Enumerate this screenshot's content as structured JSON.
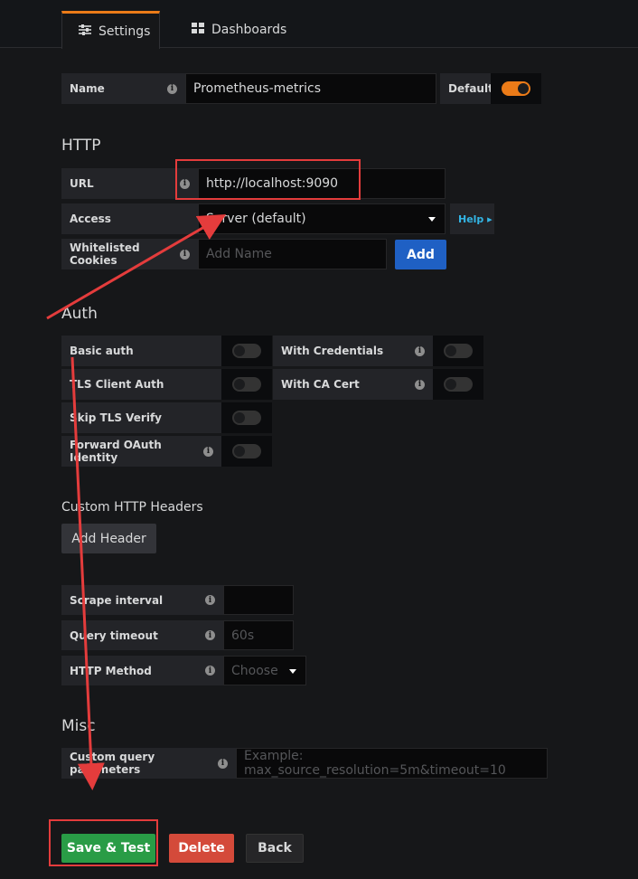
{
  "tabs": [
    {
      "label": "Settings",
      "icon": "sliders-icon",
      "active": true
    },
    {
      "label": "Dashboards",
      "icon": "grid-icon",
      "active": false
    }
  ],
  "name_row": {
    "label": "Name",
    "value": "Prometheus-metrics",
    "default_label": "Default",
    "default_on": true
  },
  "http": {
    "title": "HTTP",
    "url_label": "URL",
    "url_value": "http://localhost:9090",
    "access_label": "Access",
    "access_value": "Server (default)",
    "help_label": "Help ▸",
    "cookies_label": "Whitelisted Cookies",
    "cookies_placeholder": "Add Name",
    "add_label": "Add"
  },
  "auth": {
    "title": "Auth",
    "basic_auth": "Basic auth",
    "with_credentials": "With Credentials",
    "tls_client_auth": "TLS Client Auth",
    "with_ca_cert": "With CA Cert",
    "skip_tls_verify": "Skip TLS Verify",
    "forward_oauth": "Forward OAuth Identity"
  },
  "custom_headers": {
    "title": "Custom HTTP Headers",
    "add_header_label": "Add Header"
  },
  "prom": {
    "scrape_label": "Scrape interval",
    "scrape_value": "",
    "query_timeout_label": "Query timeout",
    "query_timeout_placeholder": "60s",
    "http_method_label": "HTTP Method",
    "http_method_value": "Choose"
  },
  "misc": {
    "title": "Misc",
    "custom_query_label": "Custom query parameters",
    "custom_query_placeholder": "Example: max_source_resolution=5m&timeout=10"
  },
  "buttons": {
    "save_test": "Save & Test",
    "delete": "Delete",
    "back": "Back"
  },
  "colors": {
    "accent": "#eb7b18",
    "primary": "#1f60c4",
    "success": "#299c46",
    "danger": "#d44a3a",
    "annotation": "#e43c3c"
  }
}
